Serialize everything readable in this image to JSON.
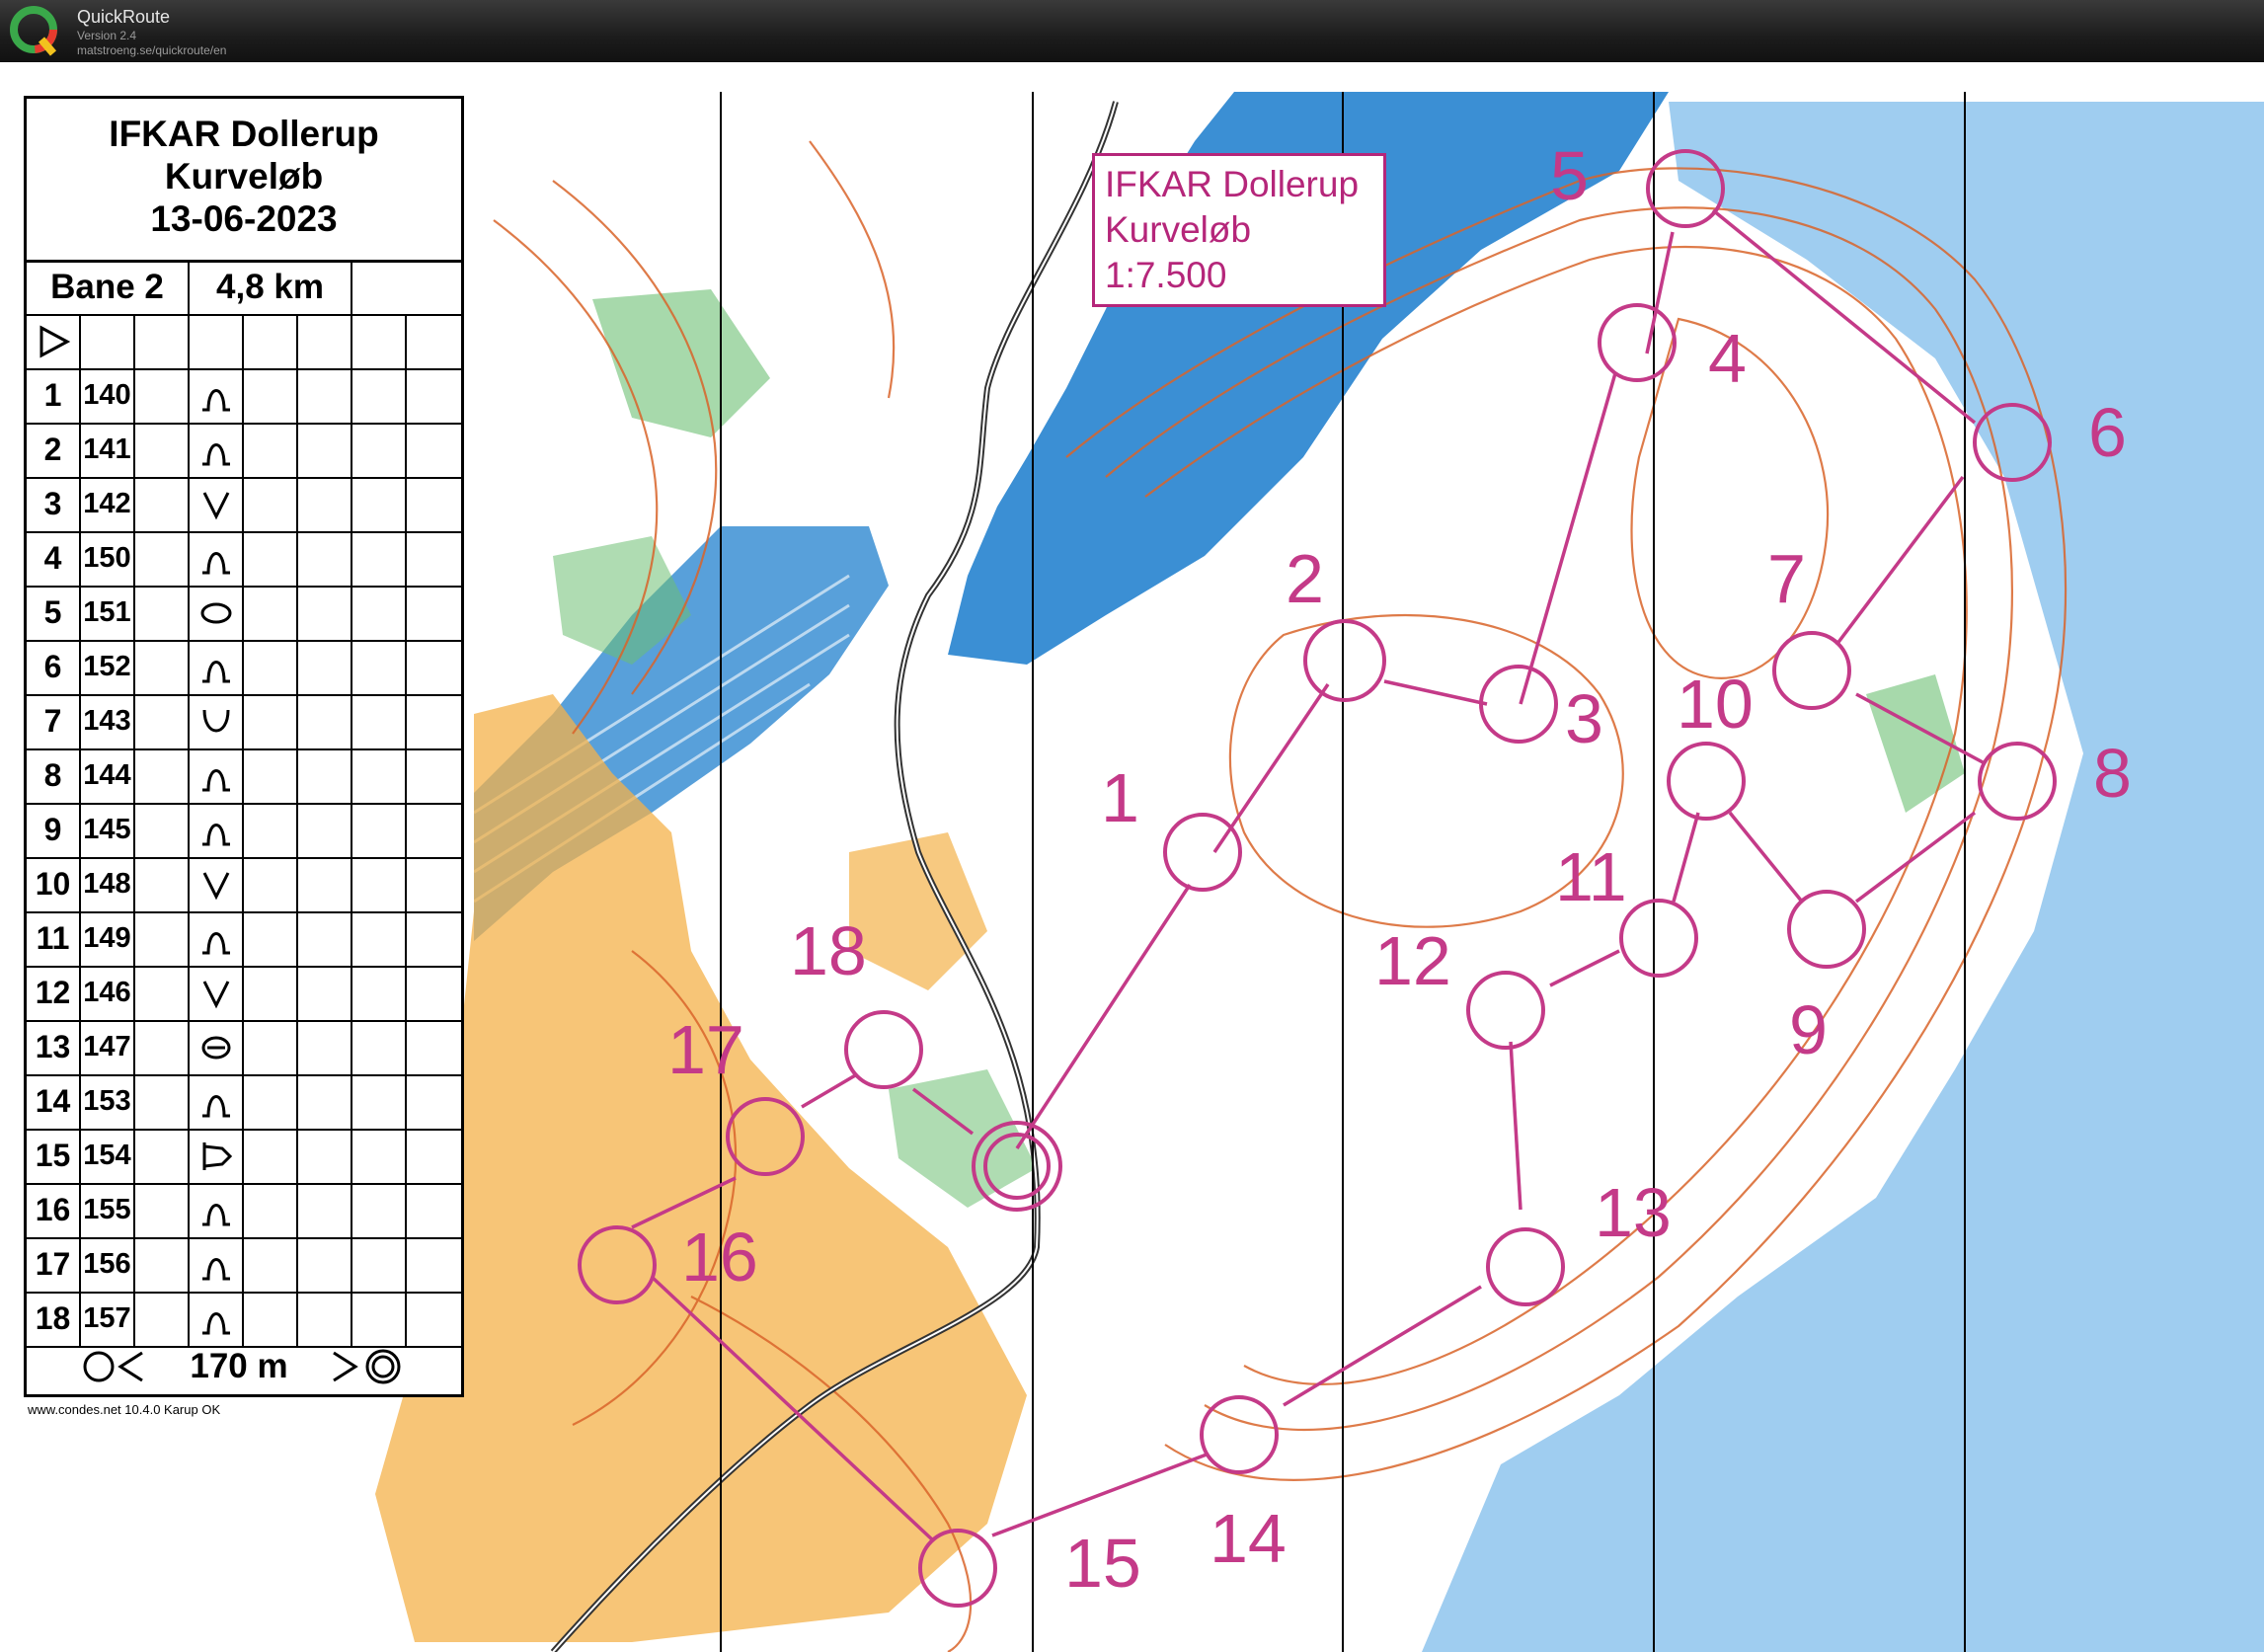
{
  "app": {
    "title": "QuickRoute",
    "version": "Version 2.4",
    "url": "matstroeng.se/quickroute/en"
  },
  "event": {
    "name": "IFKAR Dollerup",
    "type": "Kurveløb",
    "date": "13-06-2023",
    "scale": "1:7.500"
  },
  "course": {
    "name": "Bane 2",
    "length": "4,8 km",
    "finish_distance": "170 m"
  },
  "controls": [
    {
      "num": "1",
      "code": "140",
      "sym": "hill"
    },
    {
      "num": "2",
      "code": "141",
      "sym": "hill"
    },
    {
      "num": "3",
      "code": "142",
      "sym": "reentrant"
    },
    {
      "num": "4",
      "code": "150",
      "sym": "hill"
    },
    {
      "num": "5",
      "code": "151",
      "sym": "knoll"
    },
    {
      "num": "6",
      "code": "152",
      "sym": "hill"
    },
    {
      "num": "7",
      "code": "143",
      "sym": "depression"
    },
    {
      "num": "8",
      "code": "144",
      "sym": "hill"
    },
    {
      "num": "9",
      "code": "145",
      "sym": "hill"
    },
    {
      "num": "10",
      "code": "148",
      "sym": "reentrant"
    },
    {
      "num": "11",
      "code": "149",
      "sym": "hill"
    },
    {
      "num": "12",
      "code": "146",
      "sym": "reentrant"
    },
    {
      "num": "13",
      "code": "147",
      "sym": "pit"
    },
    {
      "num": "14",
      "code": "153",
      "sym": "hill"
    },
    {
      "num": "15",
      "code": "154",
      "sym": "spur"
    },
    {
      "num": "16",
      "code": "155",
      "sym": "hill"
    },
    {
      "num": "17",
      "code": "156",
      "sym": "hill"
    },
    {
      "num": "18",
      "code": "157",
      "sym": "hill"
    }
  ],
  "credit": "www.condes.net 10.4.0 Karup OK",
  "map_labels": [
    "1",
    "2",
    "3",
    "4",
    "5",
    "6",
    "7",
    "8",
    "9",
    "10",
    "11",
    "12",
    "13",
    "14",
    "15",
    "16",
    "17",
    "18"
  ],
  "colors": {
    "overprint": "#c43a88",
    "water": "#3b8fd4",
    "contour": "#d9642a",
    "open": "#f4b24a",
    "green": "#6dbf73"
  }
}
